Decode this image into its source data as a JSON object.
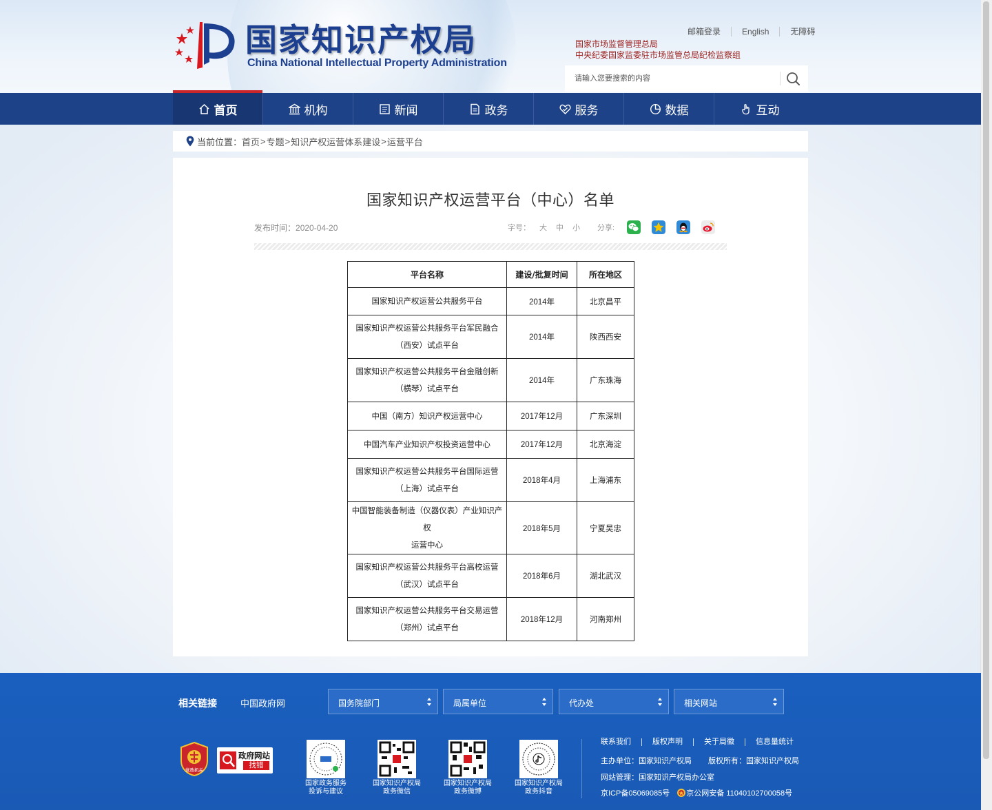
{
  "header": {
    "logo_cn": "国家知识产权局",
    "logo_en": "China National Intellectual Property Administration",
    "top_links": [
      "邮箱登录",
      "English",
      "无障碍"
    ],
    "org_lines": [
      "国家市场监督管理总局",
      "中央纪委国家监委驻市场监管总局纪检监察组"
    ],
    "search_placeholder": "请输入您要搜索的内容"
  },
  "nav": [
    {
      "label": "首页",
      "icon": "home-icon",
      "active": true
    },
    {
      "label": "机构",
      "icon": "institution-icon"
    },
    {
      "label": "新闻",
      "icon": "news-icon"
    },
    {
      "label": "政务",
      "icon": "document-icon"
    },
    {
      "label": "服务",
      "icon": "service-icon"
    },
    {
      "label": "数据",
      "icon": "pie-chart-icon"
    },
    {
      "label": "互动",
      "icon": "hand-icon"
    }
  ],
  "breadcrumb": {
    "prefix": "当前位置：",
    "items": [
      "首页",
      "专题",
      "知识产权运营体系建设",
      "运营平台"
    ],
    "separator": ">"
  },
  "article": {
    "title": "国家知识产权运营平台（中心）名单",
    "publish_label": "发布时间：",
    "publish_date": "2020-04-20",
    "font_size_label": "字号：",
    "font_sizes": [
      "大",
      "中",
      "小"
    ],
    "share_label": "分享:",
    "share_icons": [
      "wechat-icon",
      "qzone-icon",
      "qq-icon",
      "weibo-icon"
    ]
  },
  "table": {
    "headers": [
      "平台名称",
      "建设/批复时间",
      "所在地区"
    ],
    "rows": [
      {
        "name": [
          "国家知识产权运营公共服务平台"
        ],
        "time": "2014年",
        "region": "北京昌平"
      },
      {
        "name": [
          "国家知识产权运营公共服务平台军民融合",
          "（西安）试点平台"
        ],
        "time": "2014年",
        "region": "陕西西安"
      },
      {
        "name": [
          "国家知识产权运营公共服务平台金融创新",
          "（横琴）试点平台"
        ],
        "time": "2014年",
        "region": "广东珠海"
      },
      {
        "name": [
          "中国（南方）知识产权运营中心"
        ],
        "time": "2017年12月",
        "region": "广东深圳"
      },
      {
        "name": [
          "中国汽车产业知识产权投资运营中心"
        ],
        "time": "2017年12月",
        "region": "北京海淀"
      },
      {
        "name": [
          "国家知识产权运营公共服务平台国际运营",
          "（上海）试点平台"
        ],
        "time": "2018年4月",
        "region": "上海浦东"
      },
      {
        "name": [
          "中国智能装备制造（仪器仪表）产业知识产权",
          "运营中心"
        ],
        "time": "2018年5月",
        "region": "宁夏吴忠"
      },
      {
        "name": [
          "国家知识产权运营公共服务平台高校运营",
          "（武汉）试点平台"
        ],
        "time": "2018年6月",
        "region": "湖北武汉"
      },
      {
        "name": [
          "国家知识产权运营公共服务平台交易运营",
          "（郑州）试点平台"
        ],
        "time": "2018年12月",
        "region": "河南郑州"
      }
    ]
  },
  "footer": {
    "related_label": "相关链接",
    "gov_link": "中国政府网",
    "selects": [
      "国务院部门",
      "局属单位",
      "代办处",
      "相关网站"
    ],
    "badge_party": "党政机关",
    "badge_gov_title": "政府网站",
    "badge_gov_sub": "找错",
    "qr_codes": [
      {
        "caption": [
          "国家政务服务",
          "投诉与建议"
        ]
      },
      {
        "caption": [
          "国家知识产权局",
          "政务微信"
        ]
      },
      {
        "caption": [
          "国家知识产权局",
          "政务微博"
        ]
      },
      {
        "caption": [
          "国家知识产权局",
          "政务抖音"
        ]
      }
    ],
    "links": [
      "联系我们",
      "版权声明",
      "关于局徽",
      "信息量统计"
    ],
    "host": "主办单位：国家知识产权局",
    "copyright": "版权所有：国家知识产权局",
    "manage": "网站管理：国家知识产权局办公室",
    "icp": "京ICP备05069085号",
    "police": "京公网安备 11040102700058号"
  },
  "colors": {
    "nav_bg": "#1e4287",
    "nav_active_bg": "#173672",
    "accent_red": "#c9252b",
    "footer_bg": "#1a5fbf",
    "logo_blue": "#1d3f8f"
  }
}
